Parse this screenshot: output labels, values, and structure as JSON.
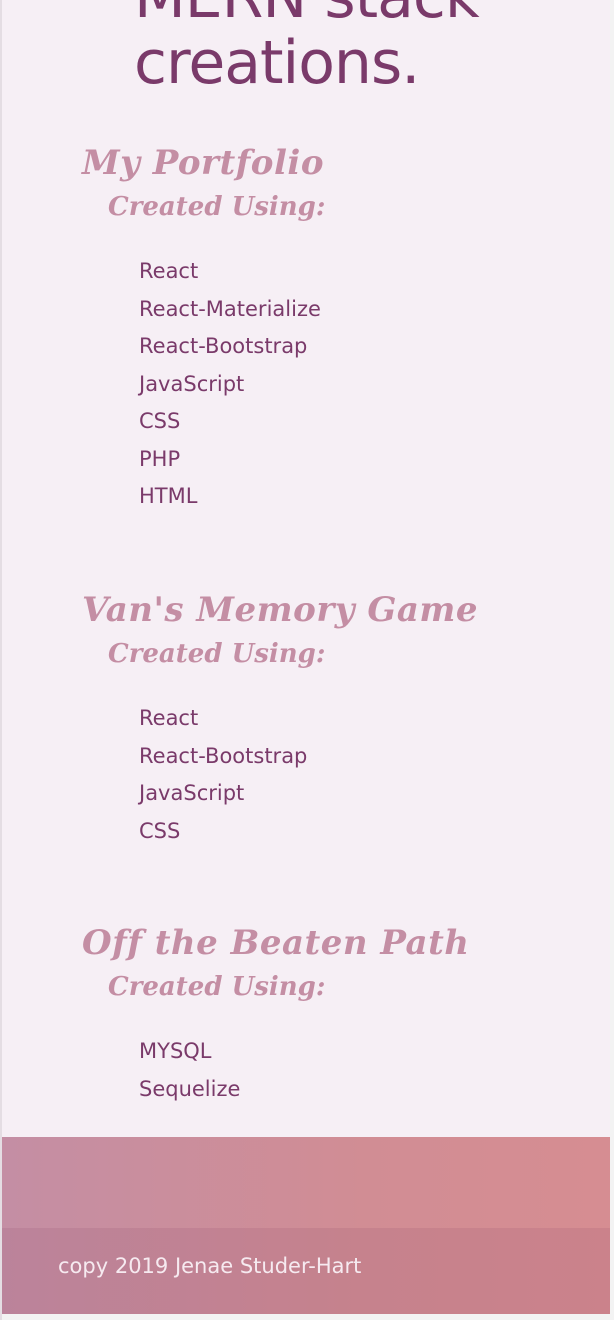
{
  "hero": {
    "line1": "MERN stack",
    "line2": "creations."
  },
  "projects": [
    {
      "title": "My Portfolio",
      "created_using": "Created Using:",
      "tech": [
        "React",
        "React-Materialize",
        "React-Bootstrap",
        "JavaScript",
        "CSS",
        "PHP",
        "HTML"
      ]
    },
    {
      "title": "Van's Memory Game",
      "created_using": "Created Using:",
      "tech": [
        "React",
        "React-Bootstrap",
        "JavaScript",
        "CSS"
      ]
    },
    {
      "title": "Off the Beaten Path",
      "created_using": "Created Using:",
      "tech": [
        "MYSQL",
        "Sequelize"
      ]
    }
  ],
  "footer": {
    "copyright": "copy 2019 Jenae Studer-Hart"
  },
  "colors": {
    "page_background": "#f6eff5",
    "text_plum": "#7a3a6a",
    "heading_pink": "#c48ea4",
    "footer_start": "#c48ea4",
    "footer_end": "#d68d92",
    "footer_text": "#f6eaf0"
  }
}
